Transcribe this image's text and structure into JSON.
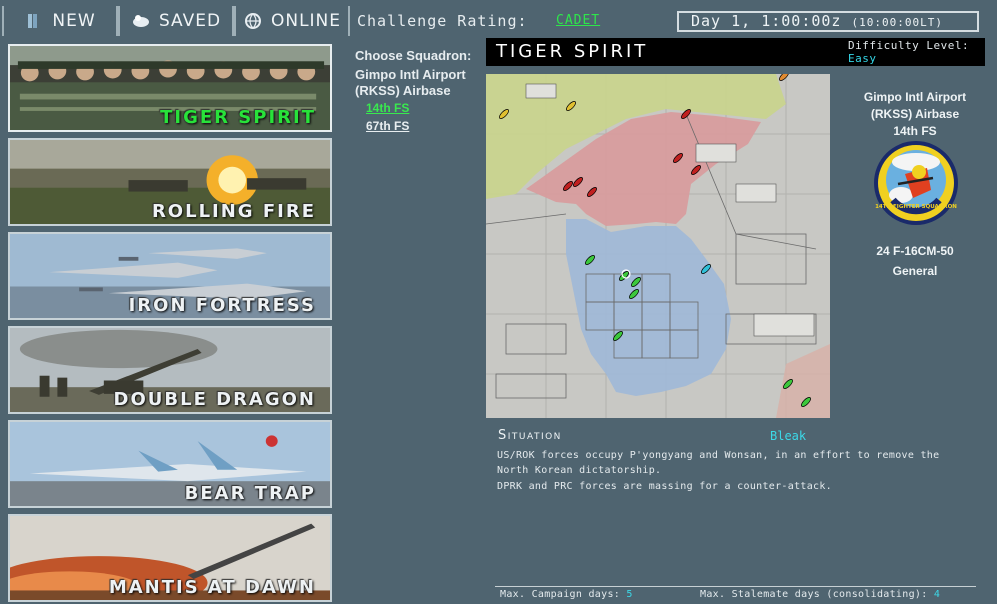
{
  "tabs": [
    {
      "label": "NEW",
      "icon": "document-icon"
    },
    {
      "label": "SAVED",
      "icon": "saved-icon"
    },
    {
      "label": "ONLINE",
      "icon": "globe-icon"
    }
  ],
  "campaigns": [
    {
      "name": "TIGER SPIRIT",
      "selected": true
    },
    {
      "name": "ROLLING FIRE",
      "selected": false
    },
    {
      "name": "IRON FORTRESS",
      "selected": false
    },
    {
      "name": "DOUBLE DRAGON",
      "selected": false
    },
    {
      "name": "BEAR TRAP",
      "selected": false
    },
    {
      "name": "MANTIS AT DAWN",
      "selected": false
    }
  ],
  "header": {
    "challenge_label": "Challenge Rating:",
    "challenge_value": "CADET",
    "clock_main": "Day 1, 1:00:00z",
    "clock_local": "(10:00:00LT)"
  },
  "squadron": {
    "label": "Choose Squadron:",
    "base_line1": "Gimpo Intl Airport",
    "base_line2": "(RKSS) Airbase",
    "options": [
      "14th FS",
      "67th FS"
    ]
  },
  "campaign_detail": {
    "title": "TIGER SPIRIT",
    "difficulty_label": "Difficulty Level:",
    "difficulty_value": "Easy"
  },
  "info": {
    "base_line1": "Gimpo Intl Airport",
    "base_line2": "(RKSS) Airbase",
    "squadron": "14th FS",
    "patch_text": "14TH FIGHTER SQUADRON",
    "aircraft": "24 F-16CM-50",
    "rank": "General"
  },
  "situation": {
    "label": "Situation",
    "value": "Bleak",
    "paragraphs": [
      "US/ROK forces occupy P'yongyang and Wonsan, in an effort to remove the North Korean dictatorship.",
      "DPRK and PRC forces are massing for a counter-attack."
    ]
  },
  "footer": {
    "campaign_days_label": "Max. Campaign days:",
    "campaign_days_value": "5",
    "stalemate_label": "Max. Stalemate days (consolidating):",
    "stalemate_value": "4"
  },
  "colors": {
    "background": "#4f6470",
    "selected_green": "#28e23a",
    "value_cyan": "#3cd9e8"
  }
}
